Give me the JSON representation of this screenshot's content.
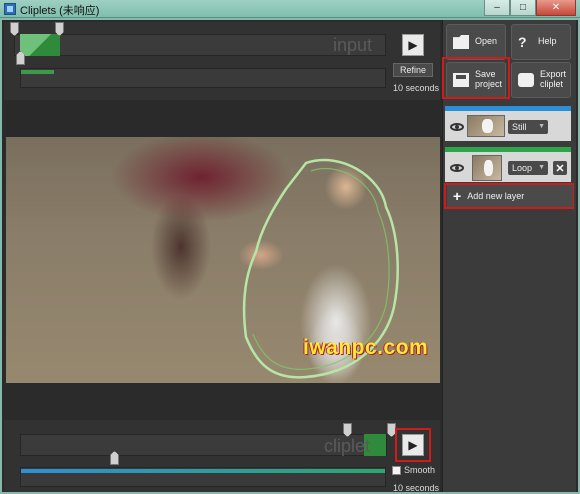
{
  "window": {
    "title": "Cliplets (未响应)"
  },
  "input_timeline": {
    "watermark": "input",
    "refine_label": "Refine",
    "duration": "10 seconds"
  },
  "output_timeline": {
    "watermark": "cliplet",
    "smooth_label": "Smooth",
    "duration": "10 seconds",
    "smooth_checked": false
  },
  "toolbar": {
    "open_label": "Open",
    "help_label": "Help",
    "save_line1": "Save",
    "save_line2": "project",
    "export_line1": "Export",
    "export_line2": "cliplet"
  },
  "layers": [
    {
      "mode": "Still",
      "bar_color": "#2a8fd6"
    },
    {
      "mode": "Loop",
      "bar_color": "#2fa44a"
    }
  ],
  "add_layer_label": "Add new layer",
  "site_watermark": "iwanpc.com",
  "icons": [
    "eye-icon",
    "folder-icon",
    "help-icon",
    "save-icon",
    "camera-icon",
    "play-icon",
    "plus-icon",
    "close-icon"
  ]
}
